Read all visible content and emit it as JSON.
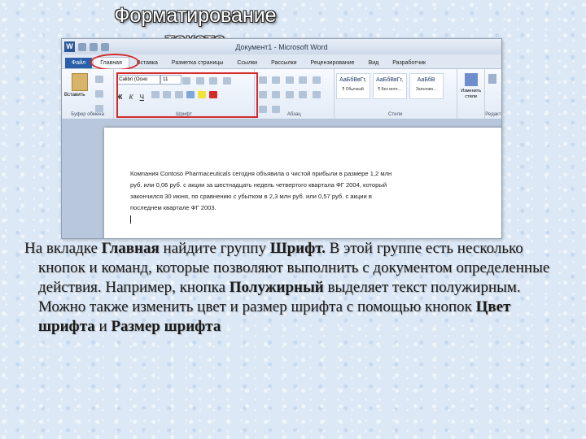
{
  "slide": {
    "title_line1": "Форматирование",
    "title_line2": "текста"
  },
  "word": {
    "window_title": "Документ1 - Microsoft Word",
    "logo_letter": "W",
    "tabs": [
      "Файл",
      "Главная",
      "Вставка",
      "Разметка страницы",
      "Ссылки",
      "Рассылки",
      "Рецензирование",
      "Вид",
      "Разработчик"
    ],
    "groups": {
      "clipboard": "Буфер обмена",
      "font": "Шрифт",
      "paragraph": "Абзац",
      "styles": "Стили",
      "editing": "Редактир..."
    },
    "paste_label": "Вставить",
    "font_name": "Calibri (Осно",
    "font_size": "11",
    "format_buttons": [
      "Ж",
      "К",
      "Ч"
    ],
    "style_samples": [
      {
        "sample": "АаБбВвГг,",
        "name": "¶ Обычный"
      },
      {
        "sample": "АаБбВвГг,",
        "name": "¶ Без инте..."
      },
      {
        "sample": "АаБбВ",
        "name": "Заголово..."
      }
    ],
    "change_styles": "Изменить стили",
    "document_lines": [
      "Компания Contoso Pharmaceuticals сегодня объявила о чистой прибыли в размере 1,2 млн",
      "руб. или 0,06 руб. с акции за шестнадцать недель четвертого квартала ФГ 2004, который",
      "закончился 30 июня, по сравнению с убытком в 2,3 млн руб. или 0,57 руб. с акции в",
      "последнем квартале ФГ 2003."
    ]
  },
  "body": {
    "t1": "На вкладке ",
    "b1": "Главная",
    "t2": " найдите группу ",
    "b2": "Шрифт.",
    "t3": " В этой группе есть несколько кнопок и команд, которые позволяют выполнить с документом определенные действия. Например, кнопка ",
    "b3": "Полужирный",
    "t4": "   выделяет текст полужирным. Можно также изменить цвет и размер шрифта с помощью кнопок ",
    "b4": "Цвет шрифта",
    "t5": "   и ",
    "b5": "Размер шрифта"
  }
}
